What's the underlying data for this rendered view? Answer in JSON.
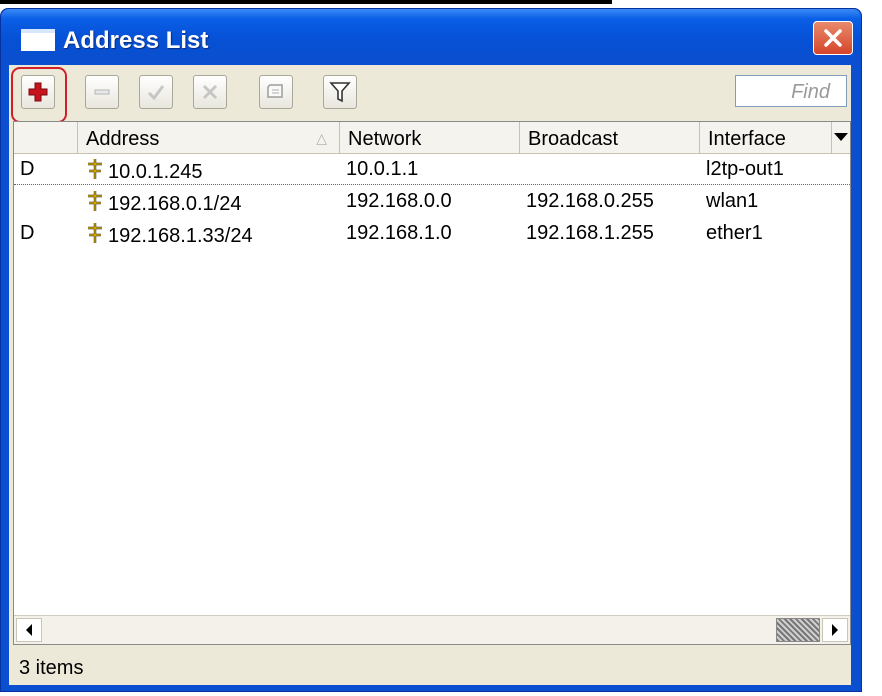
{
  "window": {
    "title": "Address List"
  },
  "toolbar": {
    "add": "add-icon",
    "remove": "minus-icon",
    "enable": "check-icon",
    "disable": "cross-icon",
    "comment": "comment-icon",
    "filter": "filter-icon",
    "find_placeholder": "Find"
  },
  "table": {
    "columns": [
      "",
      "Address",
      "Network",
      "Broadcast",
      "Interface"
    ],
    "rows": [
      {
        "flag": "D",
        "address": "10.0.1.245",
        "network": "10.0.1.1",
        "broadcast": "",
        "interface": "l2tp-out1"
      },
      {
        "flag": "",
        "address": "192.168.0.1/24",
        "network": "192.168.0.0",
        "broadcast": "192.168.0.255",
        "interface": "wlan1"
      },
      {
        "flag": "D",
        "address": "192.168.1.33/24",
        "network": "192.168.1.0",
        "broadcast": "192.168.1.255",
        "interface": "ether1"
      }
    ]
  },
  "status": {
    "count": "3 items"
  },
  "colors": {
    "titlebar": "#0a4fcf",
    "client": "#ece9d8",
    "add_highlight": "#d0202a",
    "close": "#d6452a"
  }
}
